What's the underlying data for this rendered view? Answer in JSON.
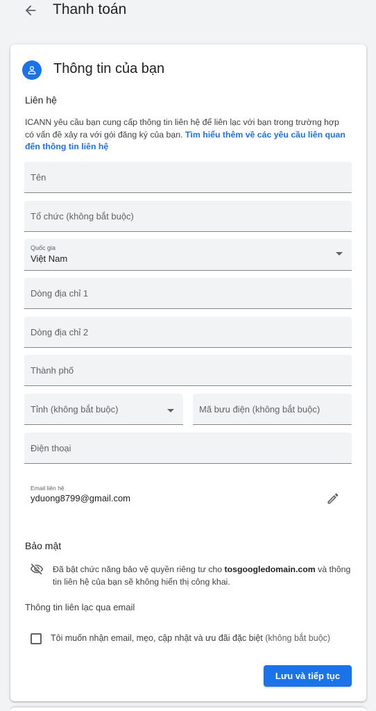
{
  "header": {
    "title": "Thanh toán"
  },
  "section": {
    "title": "Thông tin của bạn"
  },
  "contact": {
    "heading": "Liên hệ",
    "description": "ICANN yêu cầu bạn cung cấp thông tin liên hệ để liên lạc với bạn trong trường hợp có vấn đề xảy ra với gói đăng ký của bạn. ",
    "learn_more_link": "Tìm hiểu thêm về các yêu cầu liên quan đến thông tin liên hệ"
  },
  "form": {
    "name_placeholder": "Tên",
    "organization_placeholder": "Tổ chức (không bắt buộc)",
    "country_label": "Quốc gia",
    "country_value": "Việt Nam",
    "address1_placeholder": "Dòng địa chỉ 1",
    "address2_placeholder": "Dòng địa chỉ 2",
    "city_placeholder": "Thành phố",
    "province_placeholder": "Tỉnh (không bắt buộc)",
    "postal_placeholder": "Mã bưu điện (không bắt buộc)",
    "phone_placeholder": "Điện thoại",
    "email_label": "Email liên hệ",
    "email_value": "yduong8799@gmail.com"
  },
  "privacy": {
    "heading": "Bảo mật",
    "text_before": "Đã bật chức năng bảo vệ quyền riêng tư cho ",
    "domain": "tosgoogledomain.com",
    "text_after": " và thông tin liên hệ của bạn sẽ không hiển thị công khai."
  },
  "email_prefs": {
    "heading": "Thông tin liên lạc qua email",
    "checkbox_label": "Tôi muốn nhận email, mẹo, cập nhật và ưu đãi đặc biệt",
    "checkbox_optional": " (không bắt buộc)",
    "checked": false
  },
  "actions": {
    "continue_label": "Lưu và tiếp tục"
  },
  "icons": {
    "back": "arrow-back-icon",
    "avatar": "person-icon",
    "edit": "pencil-icon",
    "privacy": "visibility-off-icon",
    "dropdown": "caret-down-icon"
  },
  "colors": {
    "accent": "#1a73e8",
    "field_bg": "#f1f3f4",
    "page_bg": "#f1f3f4"
  }
}
